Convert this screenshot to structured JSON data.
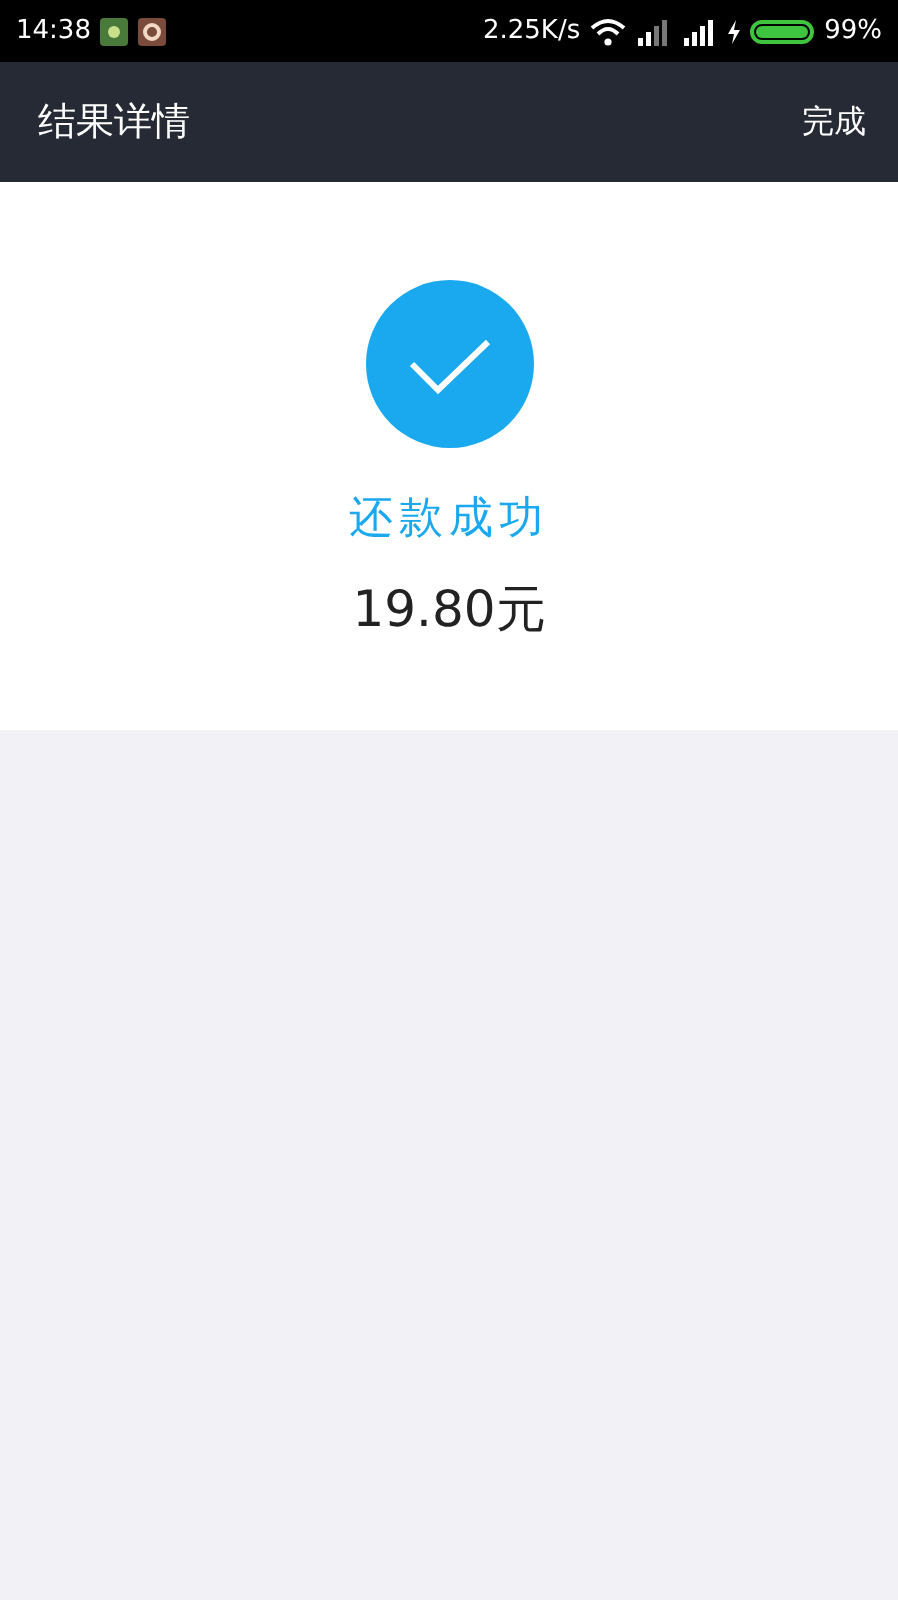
{
  "status_bar": {
    "time": "14:38",
    "speed": "2.25K/s",
    "battery": "99%"
  },
  "header": {
    "title": "结果详情",
    "action": "完成"
  },
  "result": {
    "message": "还款成功",
    "amount": "19.80元"
  }
}
